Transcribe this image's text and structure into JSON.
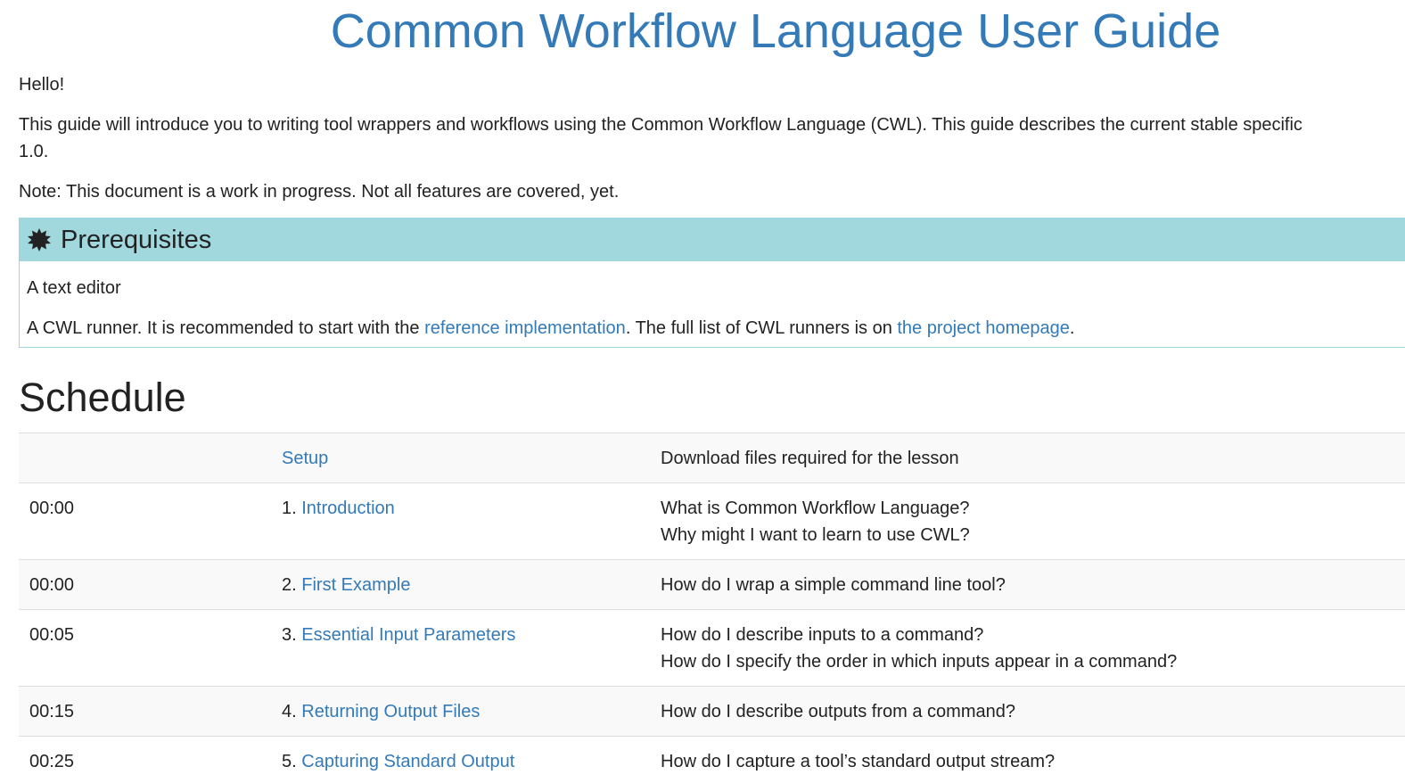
{
  "title": "Common Workflow Language User Guide",
  "intro": {
    "hello": "Hello!",
    "line1": "This guide will introduce you to writing tool wrappers and workflows using the Common Workflow Language (CWL). This guide describes the current stable specific",
    "line2": "1.0.",
    "note": "Note: This document is a work in progress. Not all features are covered, yet."
  },
  "prerequisites": {
    "heading": "Prerequisites",
    "icon": "starburst-icon",
    "item1": "A text editor",
    "item2_prefix": "A CWL runner. It is recommended to start with the ",
    "item2_link1": "reference implementation",
    "item2_middle": ". The full list of CWL runners is on ",
    "item2_link2": "the project homepage",
    "item2_suffix": "."
  },
  "schedule": {
    "heading": "Schedule",
    "rows": [
      {
        "time": "",
        "num": "",
        "link": "Setup",
        "questions": [
          "Download files required for the lesson"
        ]
      },
      {
        "time": "00:00",
        "num": "1. ",
        "link": "Introduction",
        "questions": [
          "What is Common Workflow Language?",
          "Why might I want to learn to use CWL?"
        ]
      },
      {
        "time": "00:00",
        "num": "2. ",
        "link": "First Example",
        "questions": [
          "How do I wrap a simple command line tool?"
        ]
      },
      {
        "time": "00:05",
        "num": "3. ",
        "link": "Essential Input Parameters",
        "questions": [
          "How do I describe inputs to a command?",
          "How do I specify the order in which inputs appear in a command?"
        ]
      },
      {
        "time": "00:15",
        "num": "4. ",
        "link": "Returning Output Files",
        "questions": [
          "How do I describe outputs from a command?"
        ]
      },
      {
        "time": "00:25",
        "num": "5. ",
        "link": "Capturing Standard Output",
        "questions": [
          "How do I capture a tool’s standard output stream?"
        ]
      }
    ]
  },
  "colors": {
    "link": "#337ab7",
    "callout_header": "#a0d8de"
  }
}
